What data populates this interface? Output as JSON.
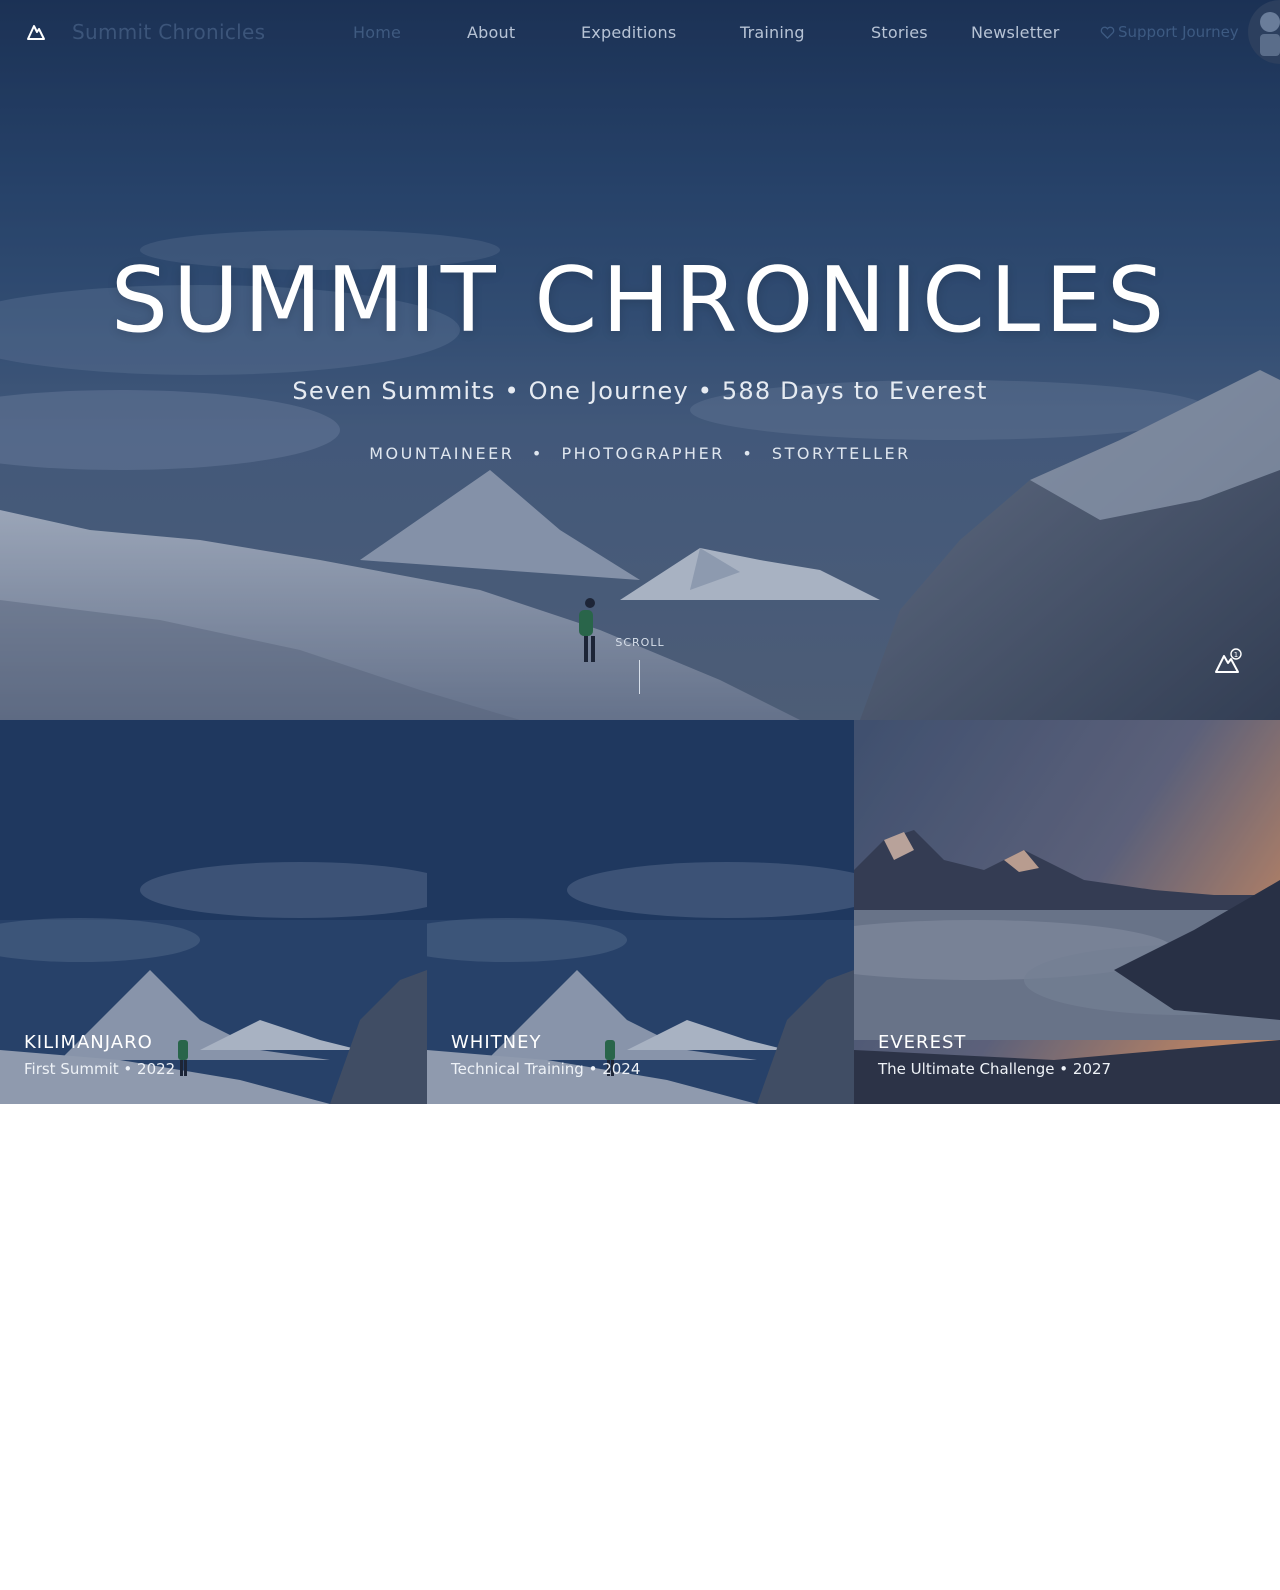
{
  "nav": {
    "brand": "Summit Chronicles",
    "links": [
      "Home",
      "About",
      "Expeditions",
      "Training",
      "Stories",
      "Newsletter"
    ],
    "support_label": "Support Journey",
    "icons": {
      "logo": "mountain-icon",
      "support": "heart-icon",
      "avatar": "avatar"
    }
  },
  "hero": {
    "title": "SUMMIT CHRONICLES",
    "subtitle": "Seven Summits • One Journey • 588 Days to Everest",
    "roles": [
      "MOUNTAINEER",
      "PHOTOGRAPHER",
      "STORYTELLER"
    ],
    "role_separator": "•",
    "scroll_label": "SCROLL",
    "corner_icon": "mountain-badge-icon"
  },
  "cards": [
    {
      "name": "KILIMANJARO",
      "meta": "First Summit • 2022"
    },
    {
      "name": "WHITNEY",
      "meta": "Technical Training • 2024"
    },
    {
      "name": "EVEREST",
      "meta": "The Ultimate Challenge • 2027"
    }
  ],
  "colors": {
    "sky_top": "#1d3558",
    "sky_mid": "#3b5a80",
    "snow": "#c9d2de",
    "sunset": "#e49a6a",
    "clouds": "#8e97a8"
  }
}
